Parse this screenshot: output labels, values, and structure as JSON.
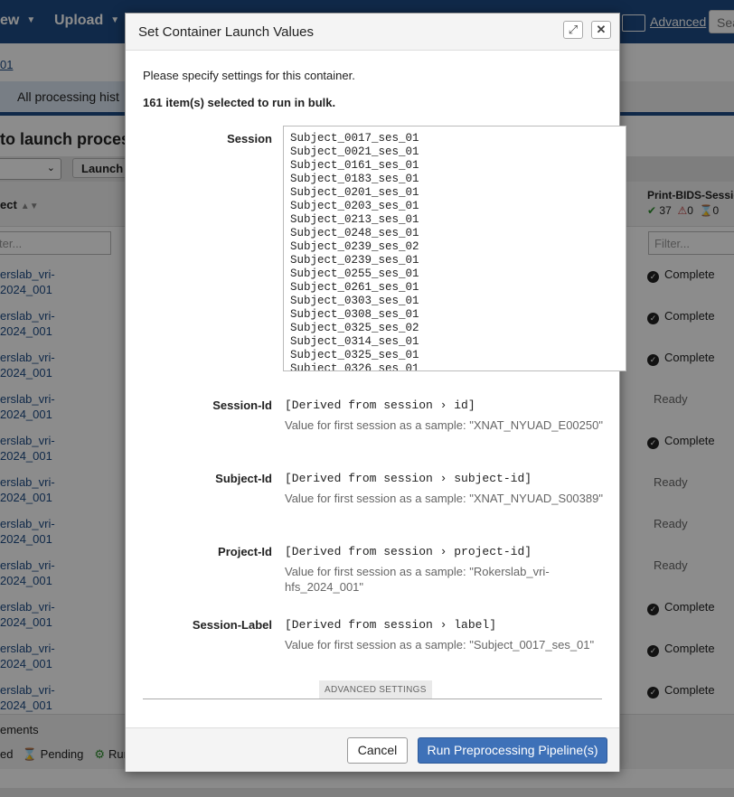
{
  "colors": {
    "nav_bg": "#1e4c85",
    "primary_button": "#3e71b8",
    "complete_icon": "#222222",
    "ready_text": "#666666"
  },
  "background": {
    "nav": {
      "item_1": "ew",
      "item_2": "Upload",
      "advanced_link": "Advanced",
      "search_placeholder": "Sea"
    },
    "breadcrumb": "01",
    "tab_label": "All processing hist",
    "heading": "to launch proces",
    "launch_button": "Launch",
    "column_subject": "ect",
    "column_print": "Print-BIDS-Sessio",
    "counts": {
      "complete": "37",
      "failed": "0",
      "pending": "0"
    },
    "filter_placeholder": "ter...",
    "filter_placeholder_right": "Filter...",
    "rows": [
      {
        "line1": "erslab_vri-",
        "line2": "2024_001",
        "status": "Complete"
      },
      {
        "line1": "erslab_vri-",
        "line2": "2024_001",
        "status": "Complete"
      },
      {
        "line1": "erslab_vri-",
        "line2": "2024_001",
        "status": "Complete"
      },
      {
        "line1": "erslab_vri-",
        "line2": "2024_001",
        "status": "Ready"
      },
      {
        "line1": "erslab_vri-",
        "line2": "2024_001",
        "status": "Complete"
      },
      {
        "line1": "erslab_vri-",
        "line2": "2024_001",
        "status": "Ready"
      },
      {
        "line1": "erslab_vri-",
        "line2": "2024_001",
        "status": "Ready"
      },
      {
        "line1": "erslab_vri-",
        "line2": "2024_001",
        "status": "Ready"
      },
      {
        "line1": "erslab_vri-",
        "line2": "2024_001",
        "status": "Complete"
      },
      {
        "line1": "erslab_vri-",
        "line2": "2024_001",
        "status": "Complete"
      },
      {
        "line1": "erslab_vri-",
        "line2": "2024_001",
        "status": "Complete"
      }
    ],
    "legend_title": "ements",
    "legend_failed": "ed",
    "legend_pending": "Pending",
    "legend_running": "Run"
  },
  "modal": {
    "title": "Set Container Launch Values",
    "intro": "Please specify settings for this container.",
    "bulk_note": "161 item(s) selected to run in bulk.",
    "session_label": "Session",
    "sessions": [
      "Subject_0017_ses_01",
      "Subject_0021_ses_01",
      "Subject_0161_ses_01",
      "Subject_0183_ses_01",
      "Subject_0201_ses_01",
      "Subject_0203_ses_01",
      "Subject_0213_ses_01",
      "Subject_0248_ses_01",
      "Subject_0239_ses_02",
      "Subject_0239_ses_01",
      "Subject_0255_ses_01",
      "Subject_0261_ses_01",
      "Subject_0303_ses_01",
      "Subject_0308_ses_01",
      "Subject_0325_ses_02",
      "Subject_0314_ses_01",
      "Subject_0325_ses_01",
      "Subject_0326_ses_01"
    ],
    "fields": [
      {
        "label": "Session-Id",
        "derived": "[Derived from session › id]",
        "hint": "Value for first session as a sample: \"XNAT_NYUAD_E00250\""
      },
      {
        "label": "Subject-Id",
        "derived": "[Derived from session › subject-id]",
        "hint": "Value for first session as a sample: \"XNAT_NYUAD_S00389\""
      },
      {
        "label": "Project-Id",
        "derived": "[Derived from session › project-id]",
        "hint": "Value for first session as a sample: \"Rokerslab_vri-hfs_2024_001\""
      },
      {
        "label": "Session-Label",
        "derived": "[Derived from session › label]",
        "hint": "Value for first session as a sample: \"Subject_0017_ses_01\""
      }
    ],
    "advanced_settings": "ADVANCED SETTINGS",
    "cancel_label": "Cancel",
    "run_label": "Run Preprocessing Pipeline(s)"
  }
}
